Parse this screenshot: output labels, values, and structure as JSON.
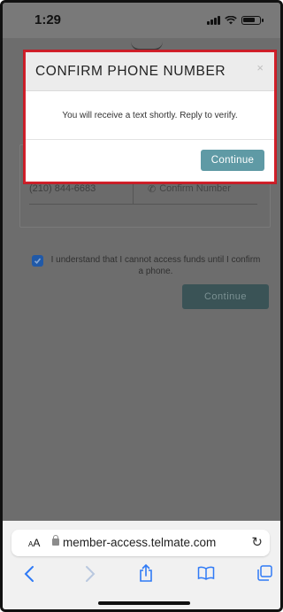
{
  "status_bar": {
    "time": "1:29"
  },
  "page": {
    "phone_number": "(210) 844-6683",
    "confirm_placeholder": "Confirm Number",
    "agree_text": "I understand that I cannot access funds until I confirm a phone.",
    "continue_label": "Continue"
  },
  "modal": {
    "title": "CONFIRM PHONE NUMBER",
    "close": "×",
    "message": "You will receive a text shortly. Reply to verify.",
    "continue_label": "Continue"
  },
  "browser": {
    "aa_label": "AA",
    "url": "member-access.telmate.com",
    "icons": [
      "reload-icon",
      "back-icon",
      "forward-icon",
      "share-icon",
      "bookmarks-icon",
      "tabs-icon"
    ]
  }
}
